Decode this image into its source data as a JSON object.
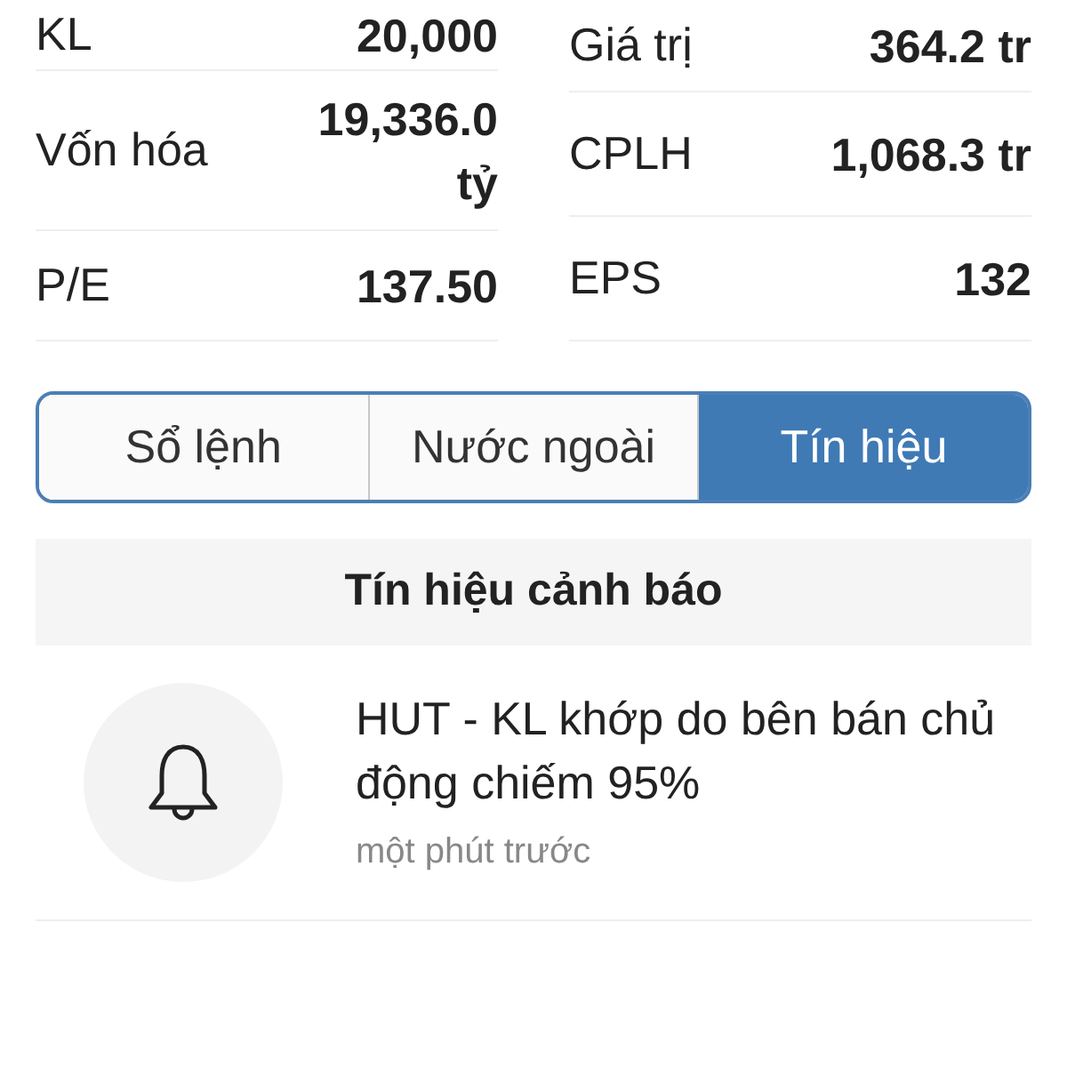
{
  "stats_left": [
    {
      "label": "KL",
      "value": "20,000"
    },
    {
      "label": "Vốn hóa",
      "value": "19,336.0 tỷ"
    },
    {
      "label": "P/E",
      "value": "137.50"
    }
  ],
  "stats_right": [
    {
      "label": "Giá trị",
      "value": "364.2 tr"
    },
    {
      "label": "CPLH",
      "value": "1,068.3 tr"
    },
    {
      "label": "EPS",
      "value": "132"
    }
  ],
  "tabs": [
    {
      "label": "Sổ lệnh",
      "selected": false
    },
    {
      "label": "Nước ngoài",
      "selected": false
    },
    {
      "label": "Tín hiệu",
      "selected": true
    }
  ],
  "section_title": "Tín hiệu cảnh báo",
  "alerts": [
    {
      "message": "HUT - KL khớp do bên bán chủ động chiếm 95%",
      "time": "một phút trước"
    }
  ]
}
